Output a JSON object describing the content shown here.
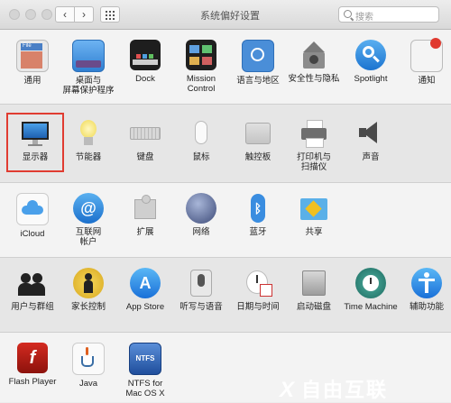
{
  "window": {
    "title": "系统偏好设置",
    "nav": {
      "back_label": "‹",
      "forward_label": "›"
    },
    "search": {
      "placeholder": "搜索"
    }
  },
  "rows": [
    {
      "items": [
        {
          "key": "general",
          "label": "通用",
          "icon": "general-icon"
        },
        {
          "key": "desktop",
          "label": "桌面与\n屏幕保护程序",
          "icon": "desktop-screensaver-icon"
        },
        {
          "key": "dock",
          "label": "Dock",
          "icon": "dock-icon"
        },
        {
          "key": "mission",
          "label": "Mission\nControl",
          "icon": "mission-control-icon"
        },
        {
          "key": "language",
          "label": "语言与地区",
          "icon": "language-region-icon"
        },
        {
          "key": "security",
          "label": "安全性与隐私",
          "icon": "security-privacy-icon"
        },
        {
          "key": "spotlight",
          "label": "Spotlight",
          "icon": "spotlight-icon"
        },
        {
          "key": "notifications",
          "label": "通知",
          "icon": "notifications-icon"
        }
      ]
    },
    {
      "items": [
        {
          "key": "displays",
          "label": "显示器",
          "icon": "displays-icon",
          "selected": true
        },
        {
          "key": "energy",
          "label": "节能器",
          "icon": "energy-saver-icon"
        },
        {
          "key": "keyboard",
          "label": "键盘",
          "icon": "keyboard-icon"
        },
        {
          "key": "mouse",
          "label": "鼠标",
          "icon": "mouse-icon"
        },
        {
          "key": "trackpad",
          "label": "触控板",
          "icon": "trackpad-icon"
        },
        {
          "key": "printers",
          "label": "打印机与\n扫描仪",
          "icon": "printers-scanners-icon"
        },
        {
          "key": "sound",
          "label": "声音",
          "icon": "sound-icon"
        }
      ]
    },
    {
      "items": [
        {
          "key": "icloud",
          "label": "iCloud",
          "icon": "icloud-icon"
        },
        {
          "key": "internet",
          "label": "互联网\n帐户",
          "icon": "internet-accounts-icon"
        },
        {
          "key": "extensions",
          "label": "扩展",
          "icon": "extensions-icon"
        },
        {
          "key": "network",
          "label": "网络",
          "icon": "network-icon"
        },
        {
          "key": "bluetooth",
          "label": "蓝牙",
          "icon": "bluetooth-icon"
        },
        {
          "key": "sharing",
          "label": "共享",
          "icon": "sharing-icon"
        }
      ]
    },
    {
      "items": [
        {
          "key": "users",
          "label": "用户与群组",
          "icon": "users-groups-icon"
        },
        {
          "key": "parental",
          "label": "家长控制",
          "icon": "parental-controls-icon"
        },
        {
          "key": "appstore",
          "label": "App Store",
          "icon": "app-store-icon"
        },
        {
          "key": "dictation",
          "label": "听写与语音",
          "icon": "dictation-speech-icon"
        },
        {
          "key": "datetime",
          "label": "日期与时间",
          "icon": "date-time-icon"
        },
        {
          "key": "startup",
          "label": "启动磁盘",
          "icon": "startup-disk-icon"
        },
        {
          "key": "timemachine",
          "label": "Time Machine",
          "icon": "time-machine-icon"
        },
        {
          "key": "accessibility",
          "label": "辅助功能",
          "icon": "accessibility-icon"
        }
      ]
    },
    {
      "items": [
        {
          "key": "flash",
          "label": "Flash Player",
          "icon": "flash-player-icon"
        },
        {
          "key": "java",
          "label": "Java",
          "icon": "java-icon"
        },
        {
          "key": "ntfs",
          "label": "NTFS for\nMac OS X",
          "icon": "ntfs-icon"
        }
      ]
    }
  ],
  "watermark": {
    "text": "自由互联"
  }
}
